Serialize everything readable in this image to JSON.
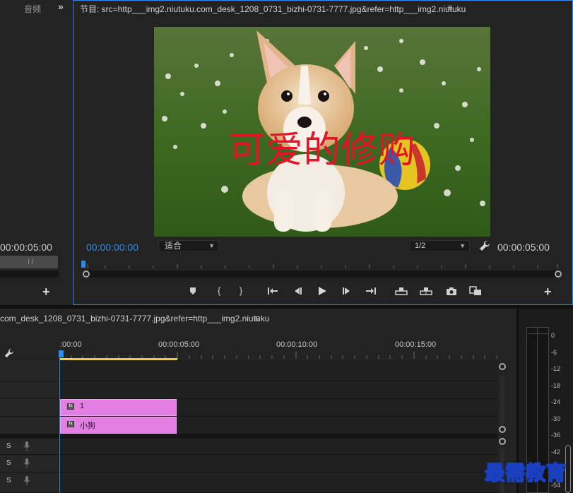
{
  "left_panel": {
    "tab_label": "音频",
    "expand_glyph": "»",
    "timecode": "00:00:05:00",
    "add_glyph": "+"
  },
  "program_monitor": {
    "title": "节目: src=http___img2.niutuku.com_desk_1208_0731_bizhi-0731-7777.jpg&refer=http___img2.niutuku",
    "menu_glyph": "≡",
    "video_caption": "可爱的修购",
    "current_timecode": "00:00:00:00",
    "fit_option": "适合",
    "resolution_option": "1/2",
    "duration_timecode": "00:00:05:00",
    "add_glyph": "+",
    "transport_icons": [
      "marker-icon",
      "mark-in-icon",
      "mark-out-icon",
      "go-to-in-icon",
      "step-back-icon",
      "play-icon",
      "step-forward-icon",
      "go-to-out-icon",
      "lift-icon",
      "extract-icon",
      "export-frame-icon",
      "compare-view-icon"
    ]
  },
  "timeline": {
    "title": "com_desk_1208_0731_bizhi-0731-7777.jpg&refer=http___img2.niutuku",
    "menu_glyph": "≡",
    "ruler_labels": [
      ":00:00",
      "00:00:05:00",
      "00:00:10:00",
      "00:00:15:00"
    ],
    "clips": [
      {
        "label": "1",
        "fx": "fx"
      },
      {
        "label": "小狗",
        "fx": "fx"
      }
    ],
    "audio_tracks": [
      {
        "solo": "S"
      },
      {
        "solo": "S"
      },
      {
        "solo": "S"
      }
    ]
  },
  "audio_meter": {
    "db_labels": [
      "0",
      "-6",
      "-12",
      "-18",
      "-24",
      "-30",
      "-36",
      "-42",
      "-48",
      "-54"
    ]
  },
  "watermark": {
    "text": "最需教育"
  },
  "colors": {
    "accent_blue": "#2d8ceb",
    "clip_pink": "#e37ee3",
    "work_area_yellow": "#e6d534",
    "caption_red": "#e1142a",
    "panel_bg": "#232323"
  }
}
